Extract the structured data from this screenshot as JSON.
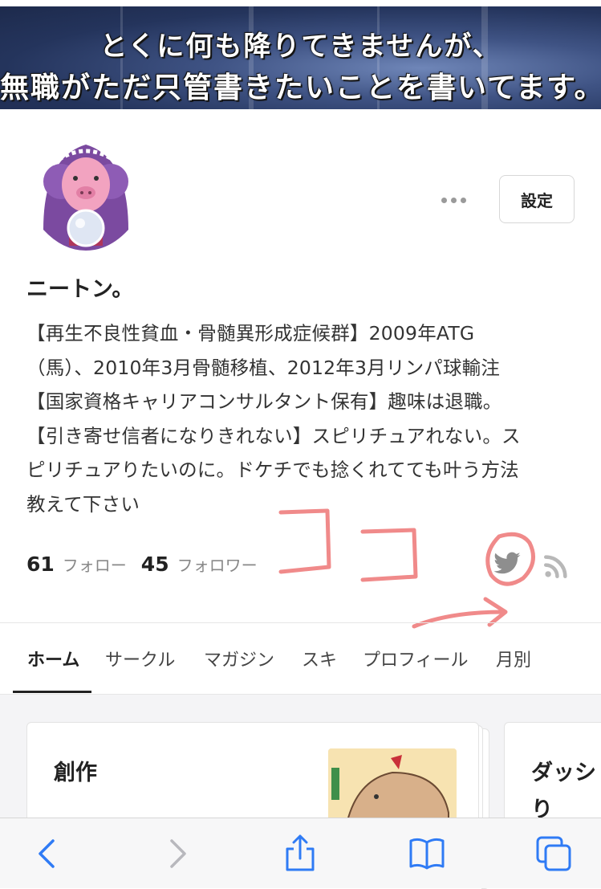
{
  "banner": {
    "line1": "とくに何も降りてきませんが、",
    "line2": "無職がただ只管書きたいことを書いてます。"
  },
  "profile": {
    "avatar_icon": "avatar-pig-fortune-teller",
    "more_icon": "more-horizontal-icon",
    "settings_label": "設定",
    "name": "ニートン。",
    "bio_lines": [
      "【再生不良性貧血・骨髄異形成症候群】2009年ATG",
      "（馬）、2010年3月骨髄移植、2012年3月リンパ球輸注",
      "【国家資格キャリアコンサルタント保有】趣味は退職。",
      "【引き寄せ信者になりきれない】スピリチュアれない。ス",
      "ピリチュアりたいのに。ドケチでも捻くれてても叶う方法",
      "教えて下さい"
    ],
    "follow_count": "61",
    "follow_label": "フォロー",
    "follower_count": "45",
    "follower_label": "フォロワー",
    "social_icons": [
      "twitter-icon",
      "rss-icon"
    ]
  },
  "annotation": {
    "text": "ココ",
    "color": "#f08a8a"
  },
  "tabs": [
    {
      "label": "ホーム",
      "active": true
    },
    {
      "label": "サークル",
      "active": false
    },
    {
      "label": "マガジン",
      "active": false
    },
    {
      "label": "スキ",
      "active": false
    },
    {
      "label": "プロフィール",
      "active": false
    },
    {
      "label": "月別",
      "active": false
    }
  ],
  "cards": [
    {
      "title": "創作"
    },
    {
      "title_line1": "ダッシ",
      "title_line2": "り"
    }
  ],
  "browser_toolbar": {
    "icons": [
      "back-icon",
      "forward-icon",
      "share-icon",
      "bookmarks-icon",
      "tabs-icon"
    ],
    "accent": "#2f7bf5",
    "disabled": "#b8b8bd"
  }
}
